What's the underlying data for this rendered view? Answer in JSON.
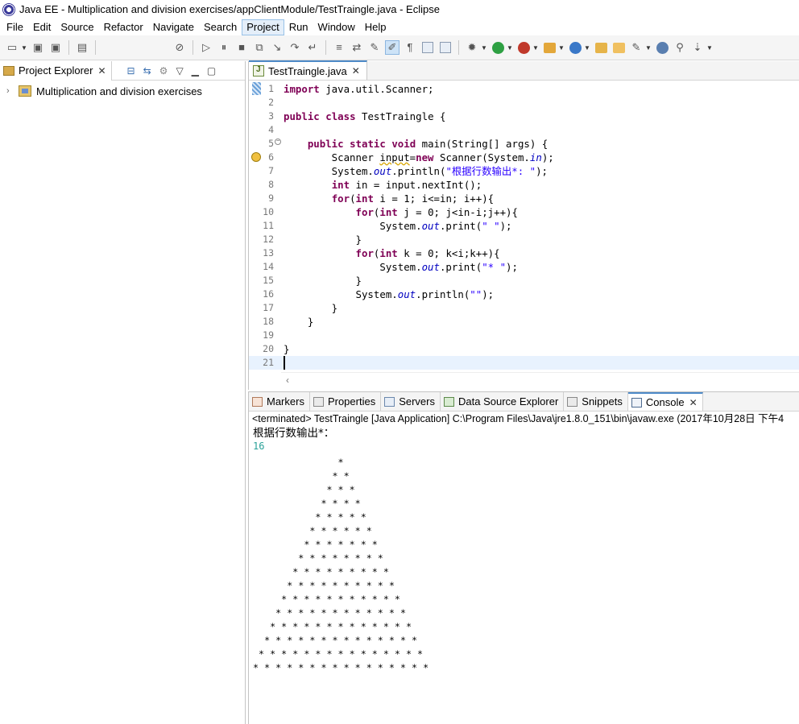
{
  "window": {
    "title": "Java EE - Multiplication and division exercises/appClientModule/TestTraingle.java - Eclipse"
  },
  "menu": [
    {
      "label": "File"
    },
    {
      "label": "Edit"
    },
    {
      "label": "Source"
    },
    {
      "label": "Refactor"
    },
    {
      "label": "Navigate"
    },
    {
      "label": "Search"
    },
    {
      "label": "Project"
    },
    {
      "label": "Run"
    },
    {
      "label": "Window"
    },
    {
      "label": "Help"
    }
  ],
  "active_menu": "Project",
  "project_explorer": {
    "tab_label": "Project Explorer",
    "close_glyph": "✕",
    "tree": [
      {
        "label": "Multiplication and division exercises",
        "expanded": false
      }
    ]
  },
  "editor": {
    "tab_label": "TestTraingle.java",
    "close_glyph": "✕",
    "line_numbers": [
      "1",
      "2",
      "3",
      "4",
      "5",
      "6",
      "7",
      "8",
      "9",
      "10",
      "11",
      "12",
      "13",
      "14",
      "15",
      "16",
      "17",
      "18",
      "19",
      "20",
      "21"
    ],
    "current_line": 21
  },
  "bottom_panel": {
    "tabs": [
      {
        "label": "Markers",
        "active": false
      },
      {
        "label": "Properties",
        "active": false
      },
      {
        "label": "Servers",
        "active": false
      },
      {
        "label": "Data Source Explorer",
        "active": false
      },
      {
        "label": "Snippets",
        "active": false
      },
      {
        "label": "Console",
        "active": true
      }
    ],
    "close_glyph": "✕",
    "status_line": "<terminated> TestTraingle [Java Application] C:\\Program Files\\Java\\jre1.8.0_151\\bin\\javaw.exe (2017年10月28日 下午4",
    "prompt_text": "根据行数输出*：",
    "input_value": "16",
    "triangle_rows": 16
  },
  "colors": {
    "keyword": "#7f0055",
    "string": "#2a00ff",
    "field": "#0000c0",
    "input": "#2aa198",
    "current_line_bg": "#e8f2fe",
    "accent": "#4e8ac8"
  }
}
